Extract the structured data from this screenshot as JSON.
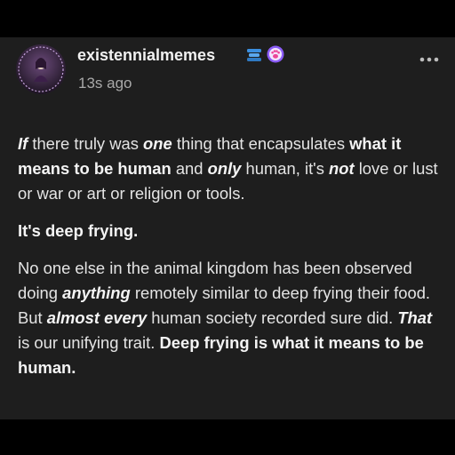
{
  "post": {
    "username": "existennialmemes",
    "timestamp": "13s ago",
    "icons": {
      "more": "more-options-icon",
      "badge_a": "blue-badge-icon",
      "badge_b": "purple-paw-badge-icon",
      "avatar": "avatar-image"
    },
    "colors": {
      "card_bg": "#1e1e1e",
      "text": "#e4e4e4",
      "muted": "#a9a9a9",
      "badge_blue": "#3b8fe0",
      "badge_purple": "#8b5cf6"
    },
    "p1": {
      "w1": "If",
      "t1": " there truly was ",
      "w2": "one",
      "t2": " thing that encapsulates ",
      "w3": "what it means to be human",
      "t3": " and ",
      "w4": "only",
      "t4": " human, it's ",
      "w5": "not",
      "t5": " love or lust or war or art or religion or tools."
    },
    "p2": "It's deep frying.",
    "p3": {
      "t1": "No one else in the animal kingdom has been observed doing ",
      "w1": "anything",
      "t2": " remotely similar to deep frying their food. But ",
      "w2": "almost every",
      "t3": " human society recorded sure did. ",
      "w3": "That",
      "t4": " is our unifying trait. ",
      "w4": "Deep frying is what it means to be human."
    }
  }
}
